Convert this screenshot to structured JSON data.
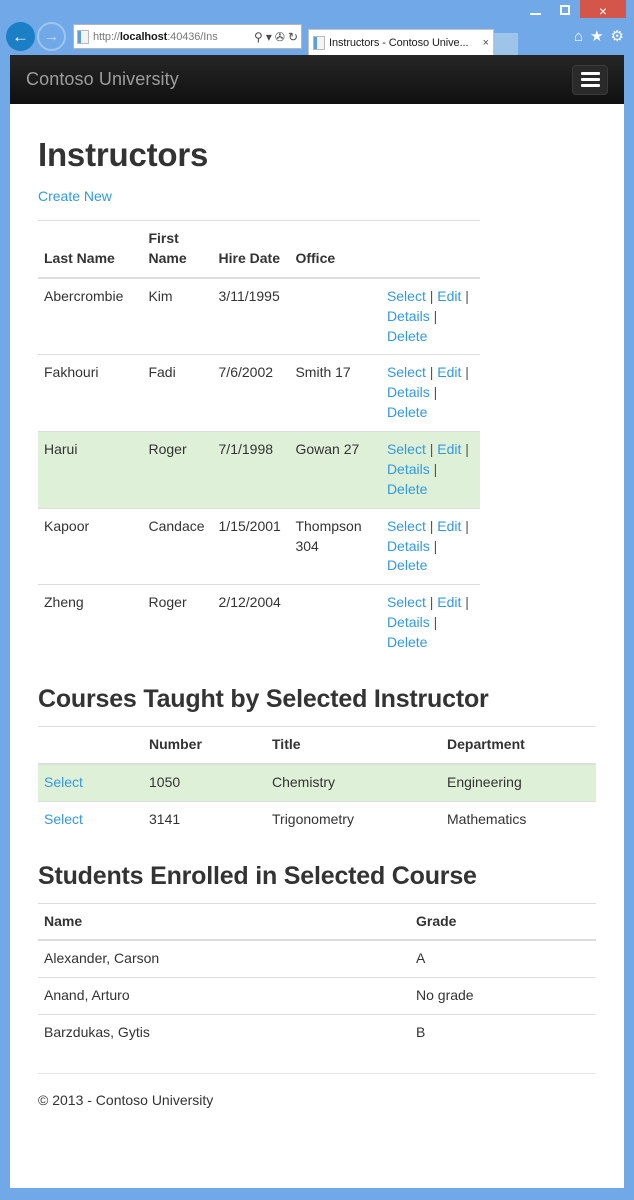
{
  "window": {
    "controls": {
      "minimize": "minimize-button",
      "maximize": "maximize-button",
      "close": "×"
    }
  },
  "browser": {
    "back_glyph": "←",
    "forward_glyph": "→",
    "address": {
      "scheme": "http://",
      "host": "localhost",
      "rest": ":40436/Ins",
      "full": "http://localhost:40436/Ins",
      "search_glyph": "⚲",
      "dropdown_glyph": "▾",
      "compat_glyph": "✇",
      "refresh_glyph": "↻"
    },
    "tab": {
      "title": "Instructors - Contoso Unive...",
      "close_glyph": "×"
    },
    "right_icons": {
      "home": "⌂",
      "favorites": "★",
      "settings": "⚙"
    }
  },
  "site": {
    "brand": "Contoso University",
    "menu_toggle_label": "Toggle navigation"
  },
  "main": {
    "page_title": "Instructors",
    "create_new_label": "Create New",
    "instructors_table": {
      "headers": [
        "Last Name",
        "First Name",
        "Hire Date",
        "Office",
        ""
      ],
      "actions": {
        "select": "Select",
        "edit": "Edit",
        "details": "Details",
        "delete": "Delete",
        "separator": "|"
      },
      "rows": [
        {
          "last_name": "Abercrombie",
          "first_name": "Kim",
          "hire_date": "3/11/1995",
          "office": "",
          "selected": false
        },
        {
          "last_name": "Fakhouri",
          "first_name": "Fadi",
          "hire_date": "7/6/2002",
          "office": "Smith 17",
          "selected": false
        },
        {
          "last_name": "Harui",
          "first_name": "Roger",
          "hire_date": "7/1/1998",
          "office": "Gowan 27",
          "selected": true
        },
        {
          "last_name": "Kapoor",
          "first_name": "Candace",
          "hire_date": "1/15/2001",
          "office": "Thompson 304",
          "selected": false
        },
        {
          "last_name": "Zheng",
          "first_name": "Roger",
          "hire_date": "2/12/2004",
          "office": "",
          "selected": false
        }
      ]
    },
    "courses_section": {
      "title": "Courses Taught by Selected Instructor",
      "headers": [
        "",
        "Number",
        "Title",
        "Department"
      ],
      "select_label": "Select",
      "rows": [
        {
          "number": "1050",
          "title": "Chemistry",
          "department": "Engineering",
          "selected": true
        },
        {
          "number": "3141",
          "title": "Trigonometry",
          "department": "Mathematics",
          "selected": false
        }
      ]
    },
    "students_section": {
      "title": "Students Enrolled in Selected Course",
      "headers": [
        "Name",
        "Grade"
      ],
      "rows": [
        {
          "name": "Alexander, Carson",
          "grade": "A"
        },
        {
          "name": "Anand, Arturo",
          "grade": "No grade"
        },
        {
          "name": "Barzdukas, Gytis",
          "grade": "B"
        }
      ]
    }
  },
  "footer": {
    "copyright": "© 2013 - Contoso University"
  },
  "colors": {
    "link": "#3399dd",
    "selected_row": "#dff0d8",
    "navbar": "#1c1c1c",
    "window_frame": "#70a8e8",
    "close_button": "#d4554a"
  }
}
